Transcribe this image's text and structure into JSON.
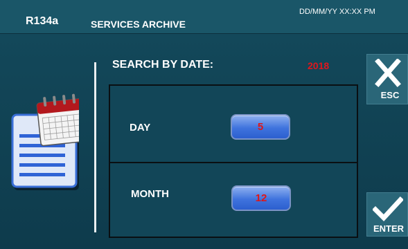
{
  "header": {
    "app_name": "R134a",
    "title": "SERVICES ARCHIVE",
    "datetime": "DD/MM/YY XX:XX PM"
  },
  "search": {
    "label": "SEARCH BY DATE:",
    "year": "2018"
  },
  "fields": {
    "day": {
      "label": "DAY",
      "value": "5"
    },
    "month": {
      "label": "MONTH",
      "value": "12"
    }
  },
  "buttons": {
    "esc": {
      "label": "ESC",
      "icon": "close-icon"
    },
    "enter": {
      "label": "ENTER",
      "icon": "checkmark-icon"
    }
  },
  "icons": {
    "left": "calendar-document-icon"
  },
  "colors": {
    "background": "#123f52",
    "header": "#1a5668",
    "value_text": "#e01616",
    "value_button": "#3f73dd"
  }
}
